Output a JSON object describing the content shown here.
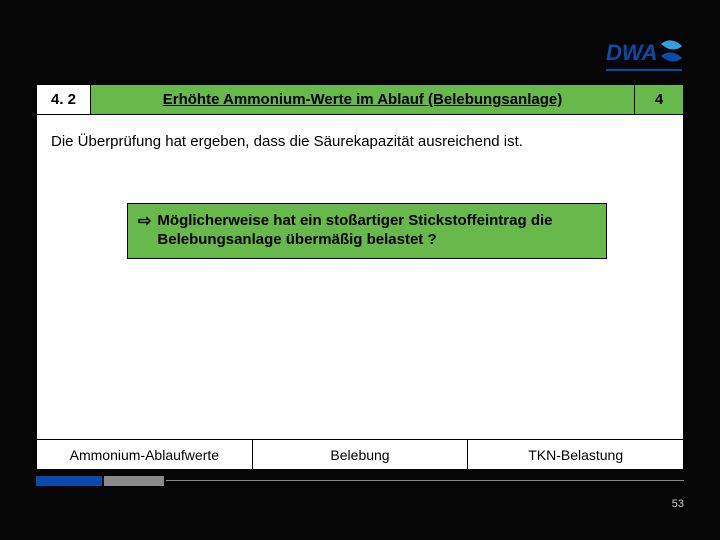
{
  "logo": {
    "text": "DWA",
    "accent": "#0a4aa8",
    "wave": "#2fa0e0"
  },
  "header": {
    "section": "4. 2",
    "title": "Erhöhte Ammonium-Werte im Ablauf (Belebungsanlage)",
    "page": "4"
  },
  "body": {
    "lead": "Die Überprüfung hat ergeben, dass die Säurekapazität ausreichend ist.",
    "callout_arrow": "⇨",
    "callout": "Möglicherweise hat ein stoßartiger Stickstoffeintrag die Belebungsanlage übermäßig belastet ?"
  },
  "footer": {
    "items": [
      "Ammonium-Ablaufwerte",
      "Belebung",
      "TKN-Belastung"
    ]
  },
  "slide_number": "53"
}
